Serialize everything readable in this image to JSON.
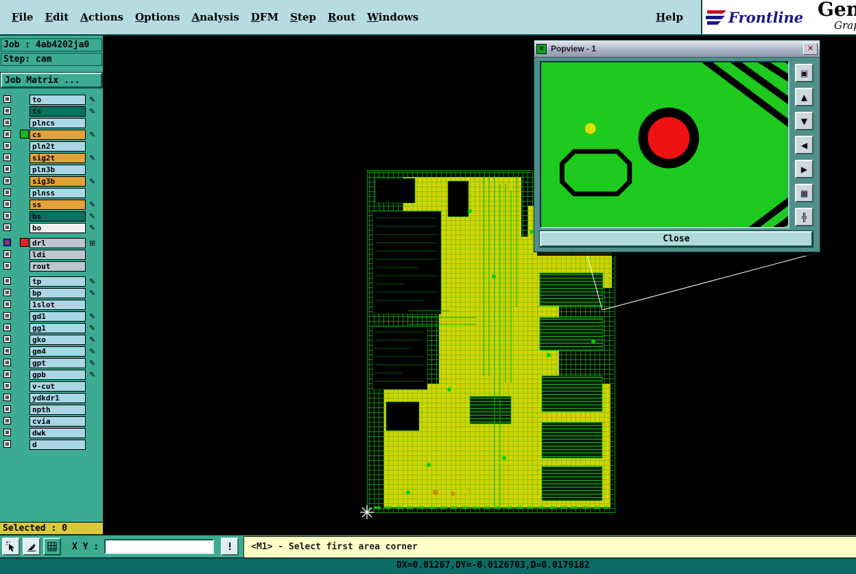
{
  "menu": {
    "items": [
      "File",
      "Edit",
      "Actions",
      "Options",
      "Analysis",
      "DFM",
      "Step",
      "Rout",
      "Windows"
    ],
    "help": "Help"
  },
  "brand": {
    "name": "Frontline",
    "product": "Gene",
    "tagline": "Grap"
  },
  "sidebar": {
    "job": "Job : 4ab4202ja0",
    "step": "Step: cam",
    "job_matrix": "Job Matrix ...",
    "selected": "Selected : 0",
    "layers": [
      {
        "name": "to",
        "style": "blue",
        "mark": "✎",
        "mark_name": "edit-pen-icon"
      },
      {
        "name": "ts",
        "style": "dark",
        "mark": "✎",
        "mark_name": "edit-pen-icon"
      },
      {
        "name": "plncs",
        "style": "blue"
      },
      {
        "name": "cs",
        "style": "orange",
        "swatch": "green",
        "mark": "✎",
        "mark_name": "edit-pen-icon"
      },
      {
        "name": "pln2t",
        "style": "blue"
      },
      {
        "name": "sig2t",
        "style": "orange",
        "mark": "✎",
        "mark_name": "edit-pen-icon"
      },
      {
        "name": "pln3b",
        "style": "blue"
      },
      {
        "name": "sig3b",
        "style": "orange",
        "mark": "✎",
        "mark_name": "edit-pen-icon"
      },
      {
        "name": "plnss",
        "style": "blue"
      },
      {
        "name": "ss",
        "style": "orange",
        "mark": "✎",
        "mark_name": "edit-pen-icon"
      },
      {
        "name": "bs",
        "style": "dark",
        "mark": "✎",
        "mark_name": "edit-pen-icon"
      },
      {
        "name": "bo",
        "style": "white",
        "mark": "✎",
        "mark_name": "edit-pen-icon"
      },
      {
        "name": "drl",
        "style": "gray",
        "swatch": "red",
        "cb": "blue",
        "gap": true,
        "mark": "⊞",
        "mark_name": "grid-mark-icon"
      },
      {
        "name": "ldi",
        "style": "gray"
      },
      {
        "name": "rout",
        "style": "gray"
      },
      {
        "name": "tp",
        "style": "blue",
        "gap": true,
        "mark": "✎",
        "mark_name": "edit-pen-icon"
      },
      {
        "name": "bp",
        "style": "blue",
        "mark": "✎",
        "mark_name": "edit-pen-icon"
      },
      {
        "name": "1slot",
        "style": "blue"
      },
      {
        "name": "gd1",
        "style": "blue",
        "mark": "✎",
        "mark_name": "edit-pen-icon"
      },
      {
        "name": "gg1",
        "style": "blue",
        "mark": "✎",
        "mark_name": "edit-pen-icon"
      },
      {
        "name": "gko",
        "style": "blue",
        "mark": "✎",
        "mark_name": "edit-pen-icon"
      },
      {
        "name": "gm4",
        "style": "blue",
        "mark": "✎",
        "mark_name": "edit-pen-icon"
      },
      {
        "name": "gpt",
        "style": "blue",
        "mark": "✎",
        "mark_name": "edit-pen-icon"
      },
      {
        "name": "gpb",
        "style": "blue",
        "mark": "✎",
        "mark_name": "edit-pen-icon"
      },
      {
        "name": "v-cut",
        "style": "blue"
      },
      {
        "name": "ydkdr1",
        "style": "blue"
      },
      {
        "name": "npth",
        "style": "blue"
      },
      {
        "name": "cvia",
        "style": "blue"
      },
      {
        "name": "dwk",
        "style": "blue"
      },
      {
        "name": "d",
        "style": "blue"
      }
    ]
  },
  "popview": {
    "title": "Popview - 1",
    "window_icon_glyph": "✕",
    "close_x_glyph": "✕",
    "close_label": "Close",
    "tools": [
      {
        "icon": "zoom-window-icon",
        "glyph": "▣"
      },
      {
        "icon": "scroll-up-icon",
        "glyph": "▲"
      },
      {
        "icon": "scroll-down-icon",
        "glyph": "▼"
      },
      {
        "icon": "scroll-left-icon",
        "glyph": "◀"
      },
      {
        "icon": "scroll-right-icon",
        "glyph": "▶"
      },
      {
        "icon": "zoom-fit-icon",
        "glyph": "▦"
      },
      {
        "icon": "pan-icon",
        "glyph": "╬"
      }
    ]
  },
  "status": {
    "xy_label": "X Y :",
    "xy_value": "",
    "alert": "!",
    "message": "<M1> - Select first area corner"
  },
  "bottom": {
    "coords": "DX=0.01267,DY=-0.0126703,D=0.0179182"
  },
  "colors": {
    "teal": "#3cab92",
    "menu_bg": "#b7dbe2",
    "row_blue": "#a9d7e6",
    "row_orange": "#e2a23a",
    "row_dark": "#0e6e60",
    "selected_yellow": "#d9c83b",
    "message_yellow": "#ffffc9",
    "bottom_teal": "#0c6b64",
    "pcb_trace_green": "#00b000",
    "pcb_copper_yellow": "#d4d400",
    "popview_green": "#1dca1d",
    "pad_red": "#ee1212"
  }
}
